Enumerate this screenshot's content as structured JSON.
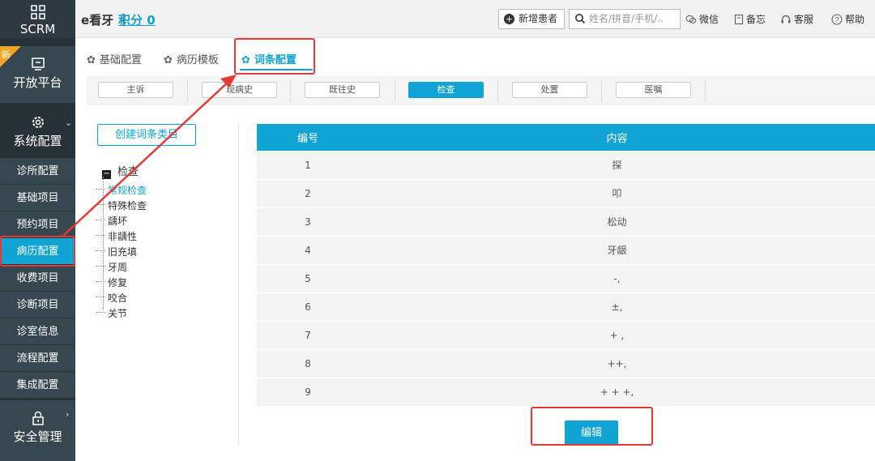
{
  "sidebar": {
    "scrm_label": "SCRM",
    "new_badge": "新",
    "open_platform_label": "开放平台",
    "system_config_label": "系统配置",
    "items": [
      {
        "label": "诊所配置"
      },
      {
        "label": "基础项目"
      },
      {
        "label": "预约项目"
      },
      {
        "label": "病历配置"
      },
      {
        "label": "收费项目"
      },
      {
        "label": "诊断项目"
      },
      {
        "label": "诊室信息"
      },
      {
        "label": "流程配置"
      },
      {
        "label": "集成配置"
      }
    ],
    "security_label": "安全管理"
  },
  "topbar": {
    "brand": "e看牙 ｜",
    "points": "积分 0",
    "new_patient": "新增患者",
    "search_placeholder": "姓名/拼音/手机/..",
    "wechat": "微信",
    "memo": "备忘",
    "service": "客服",
    "help": "帮助"
  },
  "tabs": [
    {
      "label": "基础配置"
    },
    {
      "label": "病历模板"
    },
    {
      "label": "词条配置"
    }
  ],
  "subtabs": [
    {
      "label": "主诉"
    },
    {
      "label": "现病史"
    },
    {
      "label": "既往史"
    },
    {
      "label": "检查"
    },
    {
      "label": "处置"
    },
    {
      "label": "医嘱"
    }
  ],
  "create_category_label": "创建词条类目",
  "tree": {
    "root": "检查",
    "children": [
      "常规检查",
      "特殊检查",
      "龋坏",
      "非龋性",
      "旧充填",
      "牙周",
      "修复",
      "咬合",
      "关节"
    ]
  },
  "table": {
    "headers": [
      "编号",
      "内容"
    ],
    "rows": [
      [
        "1",
        "探"
      ],
      [
        "2",
        "叩"
      ],
      [
        "3",
        "松动"
      ],
      [
        "4",
        "牙龈"
      ],
      [
        "5",
        "-,"
      ],
      [
        "6",
        "±,"
      ],
      [
        "7",
        "+ ,"
      ],
      [
        "8",
        "++,"
      ],
      [
        "9",
        "+ + +,"
      ]
    ]
  },
  "edit_label": "编辑",
  "colors": {
    "accent": "#0fa4d4",
    "sidebar_bg": "#263238",
    "annotation_red": "#e53935"
  }
}
